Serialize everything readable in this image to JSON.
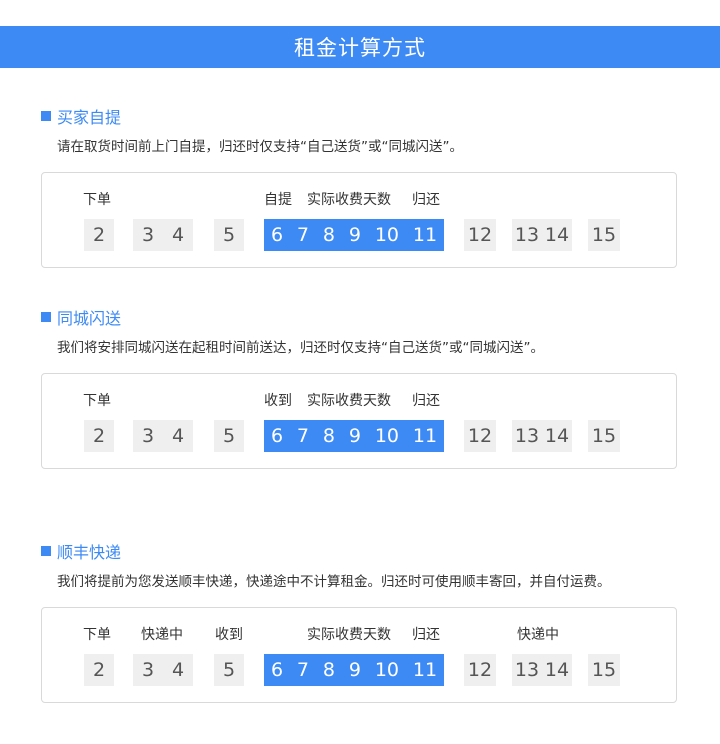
{
  "header": {
    "title": "租金计算方式"
  },
  "sections": [
    {
      "title": "买家自提",
      "desc": "请在取货时间前上门自提，归还时仅支持“自己送货”或“同城闪送”。",
      "labels": [
        "下单",
        "自提",
        "实际收费天数",
        "归还"
      ],
      "cells": [
        [
          "2"
        ],
        [
          "3",
          "4"
        ],
        [
          "5"
        ],
        [
          "6",
          "7",
          "8",
          "9",
          "10",
          "11"
        ],
        [
          "12"
        ],
        [
          "13",
          "14"
        ],
        [
          "15"
        ]
      ]
    },
    {
      "title": "同城闪送",
      "desc": "我们将安排同城闪送在起租时间前送达，归还时仅支持“自己送货”或“同城闪送”。",
      "labels": [
        "下单",
        "收到",
        "实际收费天数",
        "归还"
      ],
      "cells": [
        [
          "2"
        ],
        [
          "3",
          "4"
        ],
        [
          "5"
        ],
        [
          "6",
          "7",
          "8",
          "9",
          "10",
          "11"
        ],
        [
          "12"
        ],
        [
          "13",
          "14"
        ],
        [
          "15"
        ]
      ]
    },
    {
      "title": "顺丰快递",
      "desc": "我们将提前为您发送顺丰快递，快递途中不计算租金。归还时可使用顺丰寄回，并自付运费。",
      "labels": [
        "下单",
        "快递中",
        "收到",
        "实际收费天数",
        "归还",
        "快递中"
      ],
      "cells": [
        [
          "2"
        ],
        [
          "3",
          "4"
        ],
        [
          "5"
        ],
        [
          "6",
          "7",
          "8",
          "9",
          "10",
          "11"
        ],
        [
          "12"
        ],
        [
          "13",
          "14"
        ],
        [
          "15"
        ]
      ]
    }
  ]
}
